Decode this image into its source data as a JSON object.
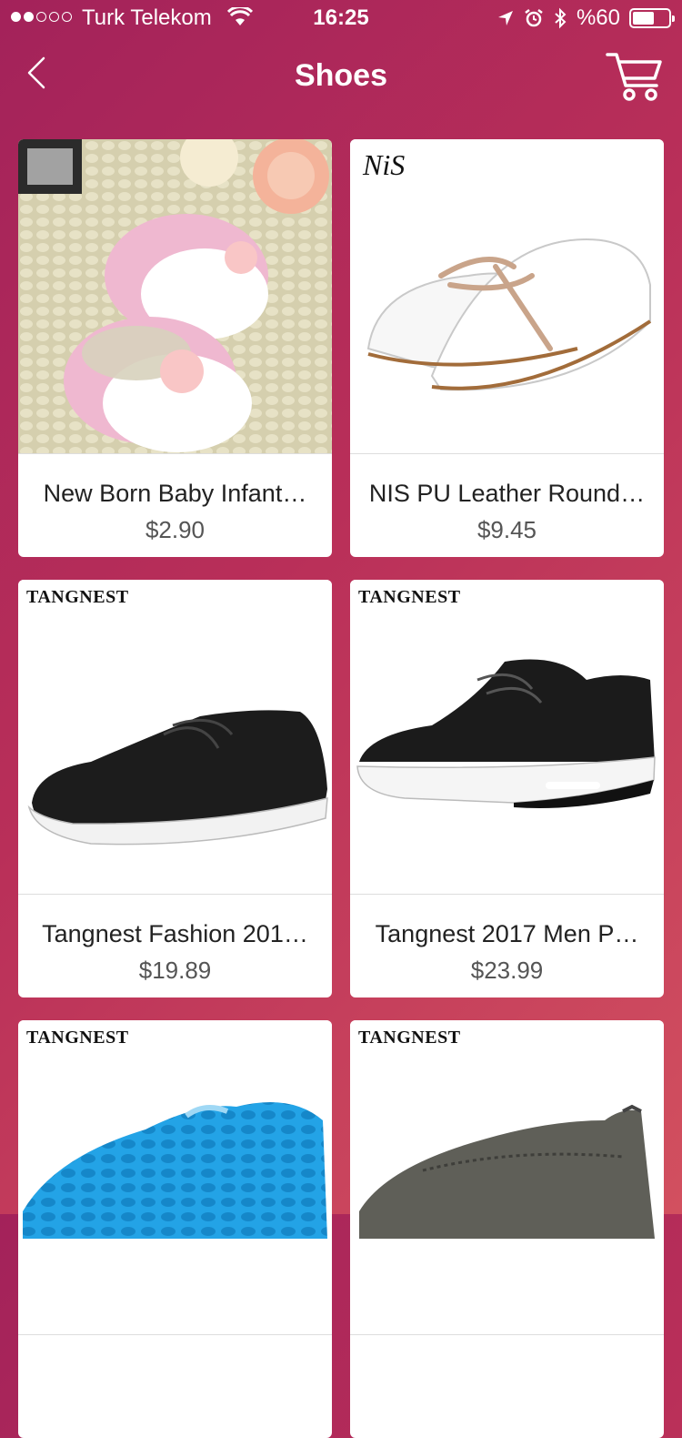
{
  "status_bar": {
    "carrier": "Turk Telekom",
    "time": "16:25",
    "battery": "%60",
    "battery_level": 0.6,
    "signal_bars_filled": 2,
    "signal_bars_total": 5,
    "icons": [
      "wifi-icon",
      "location-arrow-icon",
      "alarm-icon",
      "bluetooth-icon",
      "battery-icon"
    ]
  },
  "nav": {
    "title": "Shoes",
    "back_icon": "chevron-left-icon",
    "cart_icon": "shopping-cart-icon"
  },
  "products": [
    {
      "title": "New Born Baby Infant…",
      "price": "$2.90",
      "brand": "",
      "image": "pink-baby-shoes"
    },
    {
      "title": "NIS PU Leather Round…",
      "price": "$9.45",
      "brand": "NiS",
      "image": "white-lace-up-shoes"
    },
    {
      "title": "Tangnest  Fashion 201…",
      "price": "$19.89",
      "brand": "TANGNEST",
      "image": "black-leather-sneaker"
    },
    {
      "title": "Tangnest 2017 Men P…",
      "price": "$23.99",
      "brand": "TANGNEST",
      "image": "black-sport-sneaker"
    },
    {
      "title": "",
      "price": "",
      "brand": "TANGNEST",
      "image": "blue-mesh-slip-on"
    },
    {
      "title": "",
      "price": "",
      "brand": "TANGNEST",
      "image": "grey-slip-on-loafer"
    }
  ],
  "colors": {
    "background_start": "#a3225a",
    "background_end": "#d2505f",
    "card": "#ffffff"
  }
}
